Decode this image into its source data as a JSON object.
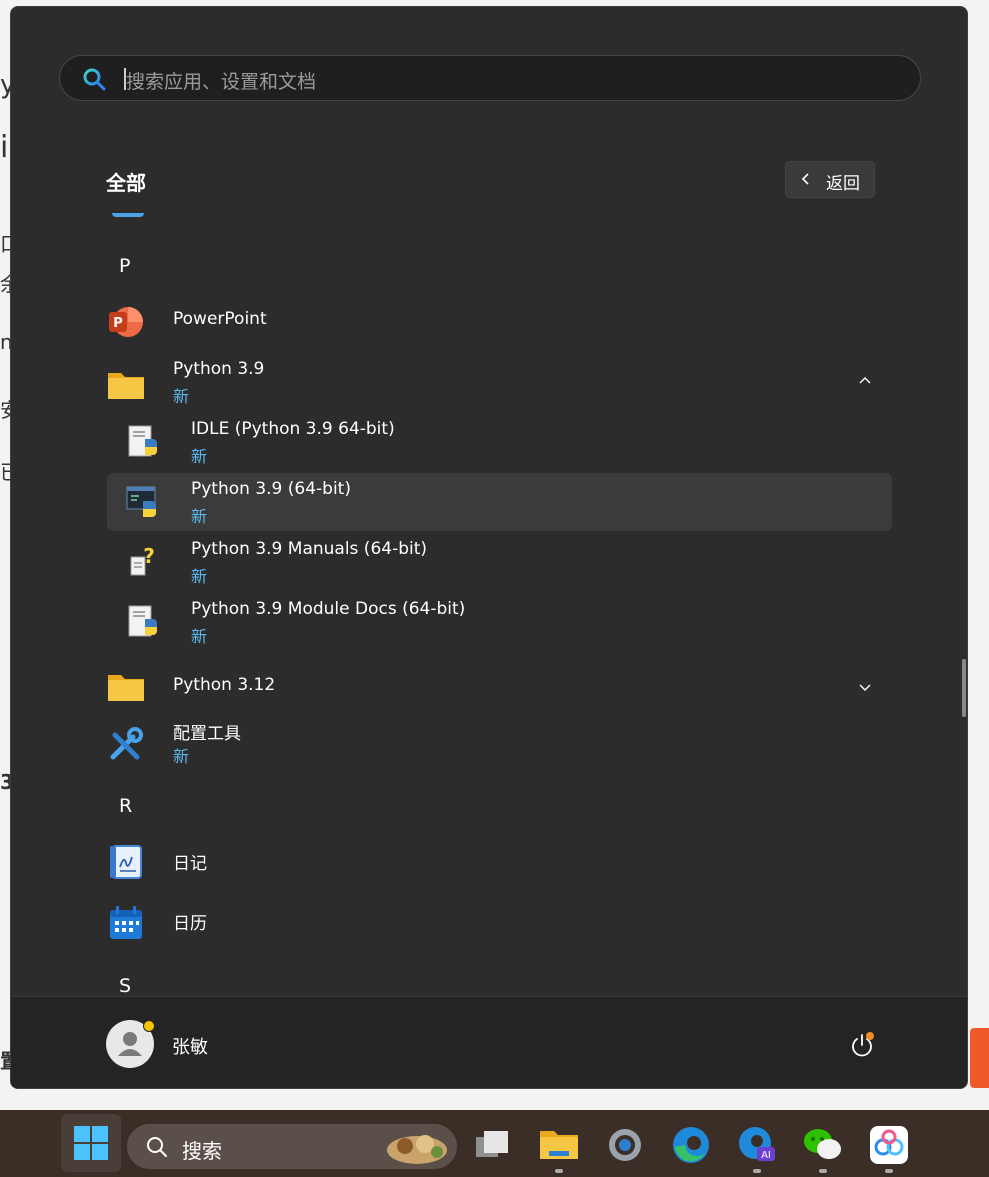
{
  "search": {
    "placeholder": "搜索应用、设置和文档"
  },
  "header": {
    "title": "全部",
    "back_label": "返回"
  },
  "letters": {
    "p": "P",
    "r": "R",
    "s": "S"
  },
  "apps": [
    {
      "name": "PowerPoint",
      "badge": ""
    },
    {
      "name": "Python 3.9",
      "badge": "新"
    },
    {
      "name": "IDLE (Python 3.9 64-bit)",
      "badge": "新"
    },
    {
      "name": "Python 3.9 (64-bit)",
      "badge": "新"
    },
    {
      "name": "Python 3.9 Manuals (64-bit)",
      "badge": "新"
    },
    {
      "name": "Python 3.9 Module Docs (64-bit)",
      "badge": "新"
    },
    {
      "name": "Python 3.12",
      "badge": ""
    },
    {
      "name": "配置工具",
      "badge": "新"
    },
    {
      "name": "日记",
      "badge": ""
    },
    {
      "name": "日历",
      "badge": ""
    }
  ],
  "footer": {
    "user_name": "张敏"
  },
  "taskbar": {
    "search_label": "搜索"
  },
  "colors": {
    "accent_new": "#5cb8f0",
    "panel_bg": "#2c2c2c",
    "folder": "#f6c744"
  }
}
